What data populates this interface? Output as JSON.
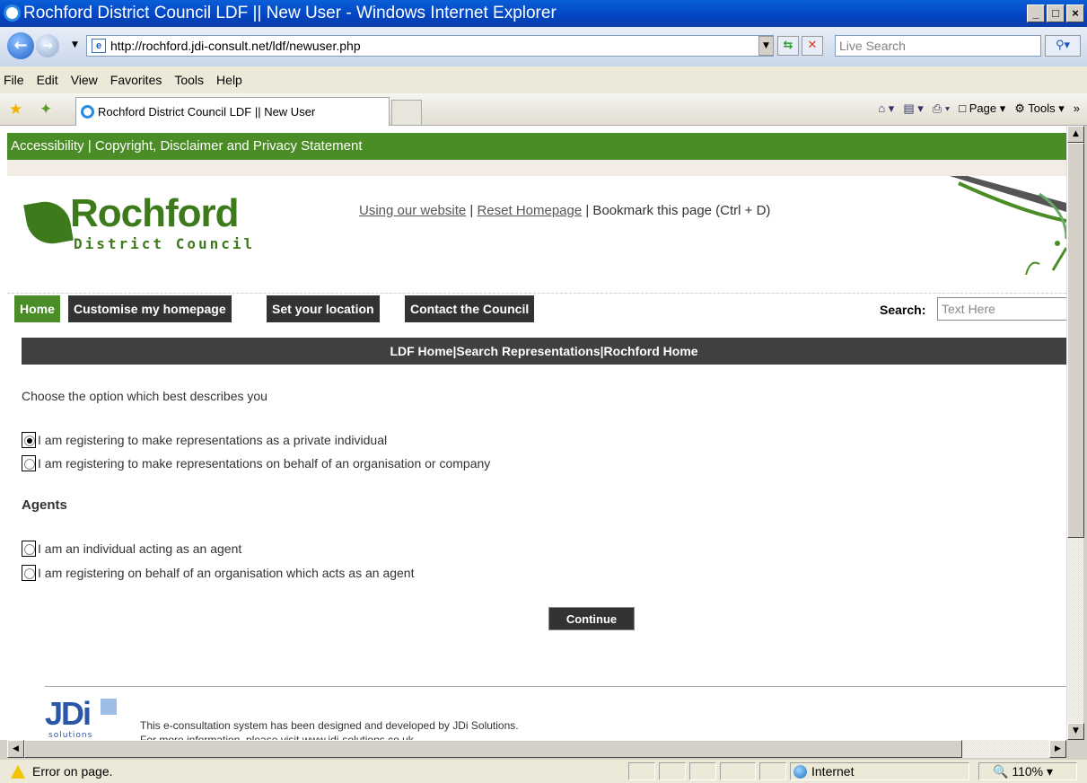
{
  "window": {
    "title": "Rochford District Council LDF || New User - Windows Internet Explorer",
    "buttons": [
      "_",
      "□",
      "×"
    ]
  },
  "address": {
    "url": "http://rochford.jdi-consult.net/ldf/newuser.php",
    "search_placeholder": "Live Search"
  },
  "menu": [
    "File",
    "Edit",
    "View",
    "Favorites",
    "Tools",
    "Help"
  ],
  "tab": {
    "label": "Rochford District Council LDF || New User"
  },
  "commands": {
    "page": "Page",
    "tools": "Tools"
  },
  "page": {
    "top_links": "Accessibility | Copyright, Disclaimer and Privacy Statement",
    "logo_name": "Rochford",
    "logo_sub": "District Council",
    "header_link1": "Using our website",
    "header_sep": " | ",
    "header_link2": "Reset Homepage",
    "header_rest": " | Bookmark this page (Ctrl + D)",
    "nav": [
      "Home",
      "Customise my homepage",
      "Set your location",
      "Contact the Council"
    ],
    "search_label": "Search:",
    "search_placeholder": "Text Here",
    "bar_links": "LDF Home|Search Representations|Rochford Home",
    "prompt": "Choose the option which best describes you",
    "options": [
      "I am registering to make representations as a private individual",
      "I am registering to make representations on behalf of an organisation or company"
    ],
    "agents_heading": "Agents",
    "agent_options": [
      "I am an individual acting as an agent",
      "I am registering on behalf of an organisation which acts as an agent"
    ],
    "continue_label": "Continue",
    "footer_logo": "JDi",
    "footer_logo_sub": "solutions",
    "footer_line1": "This e-consultation system has been designed and developed by JDi Solutions.",
    "footer_line2": "For more information, please visit www.jdi-solutions.co.uk"
  },
  "status": {
    "message": "Error on page.",
    "zone": "Internet",
    "zoom": "110%"
  }
}
